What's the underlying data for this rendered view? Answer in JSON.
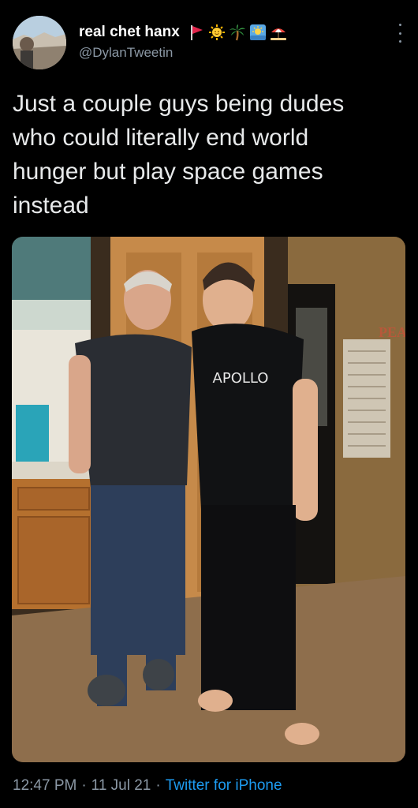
{
  "author": {
    "display_name": "real chet hanx",
    "handle": "@DylanTweetin",
    "emojis": [
      "red-flag-icon",
      "sun-icon",
      "palm-tree-icon",
      "sunrise-icon",
      "beach-umbrella-icon"
    ]
  },
  "tweet": {
    "text": "Just a couple guys being dudes\nwho could literally end world\nhunger but play space games\ninstead",
    "media": {
      "shirt_print": "APOLLO",
      "wall_sign": "PEA"
    }
  },
  "meta": {
    "time": "12:47 PM",
    "separator": "·",
    "date": "11 Jul 21",
    "source": "Twitter for iPhone"
  },
  "colors": {
    "background": "#000000",
    "text_primary": "#e7e9ea",
    "text_secondary": "#8b98a5",
    "link": "#1d9bf0"
  }
}
